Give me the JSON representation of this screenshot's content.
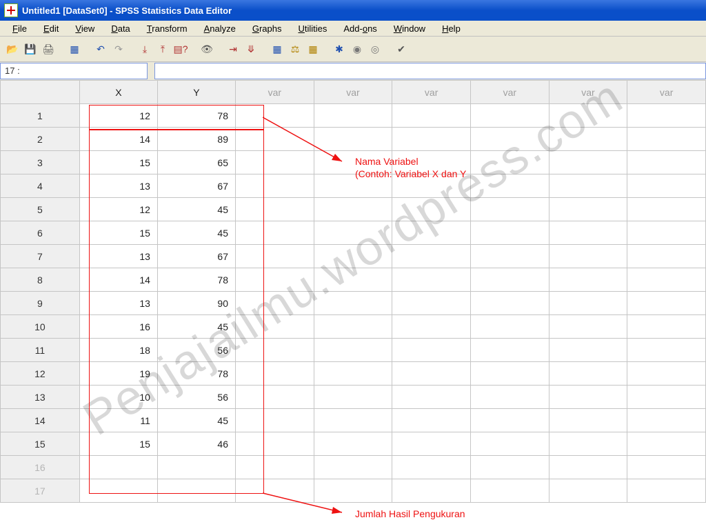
{
  "window": {
    "title": "Untitled1 [DataSet0] - SPSS Statistics Data Editor"
  },
  "menu": {
    "file": "File",
    "edit": "Edit",
    "view": "View",
    "data": "Data",
    "transform": "Transform",
    "analyze": "Analyze",
    "graphs": "Graphs",
    "utilities": "Utilities",
    "addons": "Add-ons",
    "window": "Window",
    "help": "Help"
  },
  "cellref": {
    "value": "17 :"
  },
  "columns": {
    "c0": "X",
    "c1": "Y",
    "var": "var"
  },
  "rows": [
    {
      "n": "1",
      "x": "12",
      "y": "78"
    },
    {
      "n": "2",
      "x": "14",
      "y": "89"
    },
    {
      "n": "3",
      "x": "15",
      "y": "65"
    },
    {
      "n": "4",
      "x": "13",
      "y": "67"
    },
    {
      "n": "5",
      "x": "12",
      "y": "45"
    },
    {
      "n": "6",
      "x": "15",
      "y": "45"
    },
    {
      "n": "7",
      "x": "13",
      "y": "67"
    },
    {
      "n": "8",
      "x": "14",
      "y": "78"
    },
    {
      "n": "9",
      "x": "13",
      "y": "90"
    },
    {
      "n": "10",
      "x": "16",
      "y": "45"
    },
    {
      "n": "11",
      "x": "18",
      "y": "56"
    },
    {
      "n": "12",
      "x": "19",
      "y": "78"
    },
    {
      "n": "13",
      "x": "10",
      "y": "56"
    },
    {
      "n": "14",
      "x": "11",
      "y": "45"
    },
    {
      "n": "15",
      "x": "15",
      "y": "46"
    }
  ],
  "ghost_rows": [
    "16",
    "17"
  ],
  "annotations": {
    "label1_line1": "Nama Variabel",
    "label1_line2": "(Contoh: Variabel X dan Y",
    "label2": "Jumlah Hasil Pengukuran"
  },
  "watermark": "Penjajailmu.wordpress.com"
}
